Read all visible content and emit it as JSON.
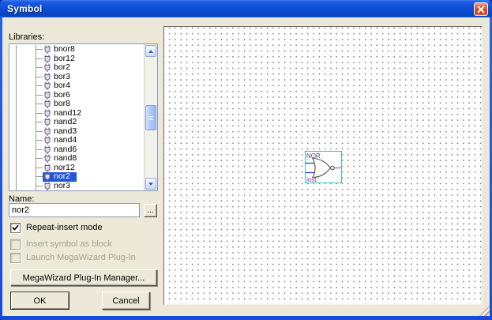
{
  "window": {
    "title": "Symbol"
  },
  "libraries": {
    "label": "Libraries:",
    "items": [
      {
        "label": "bnor8",
        "selected": false
      },
      {
        "label": "bor12",
        "selected": false
      },
      {
        "label": "bor2",
        "selected": false
      },
      {
        "label": "bor3",
        "selected": false
      },
      {
        "label": "bor4",
        "selected": false
      },
      {
        "label": "bor6",
        "selected": false
      },
      {
        "label": "bor8",
        "selected": false
      },
      {
        "label": "nand12",
        "selected": false
      },
      {
        "label": "nand2",
        "selected": false
      },
      {
        "label": "nand3",
        "selected": false
      },
      {
        "label": "nand4",
        "selected": false
      },
      {
        "label": "nand6",
        "selected": false
      },
      {
        "label": "nand8",
        "selected": false
      },
      {
        "label": "nor12",
        "selected": false
      },
      {
        "label": "nor2",
        "selected": true
      },
      {
        "label": "nor3",
        "selected": false
      }
    ]
  },
  "name_field": {
    "label": "Name:",
    "value": "nor2",
    "browse_label": "..."
  },
  "checkboxes": [
    {
      "label": "Repeat-insert mode",
      "checked": true,
      "enabled": true
    },
    {
      "label": "Insert symbol as block",
      "checked": false,
      "enabled": false
    },
    {
      "label": "Launch MegaWizard Plug-In",
      "checked": false,
      "enabled": false
    }
  ],
  "buttons": {
    "megawizard": "MegaWizard Plug-In Manager...",
    "ok": "OK",
    "cancel": "Cancel"
  },
  "preview": {
    "symbol": {
      "title": "NOR",
      "instance": "inst"
    }
  },
  "colors": {
    "titlebar_blue": "#0D4FD8",
    "selection_blue": "#2458D8",
    "dialog_bg": "#ECE9D8",
    "symbol_border": "#3FBFBF",
    "input_pin": "#2040D0",
    "output_pin": "#C050C8",
    "instance_text": "#A020A0",
    "symbol_title_text": "#44446A"
  }
}
